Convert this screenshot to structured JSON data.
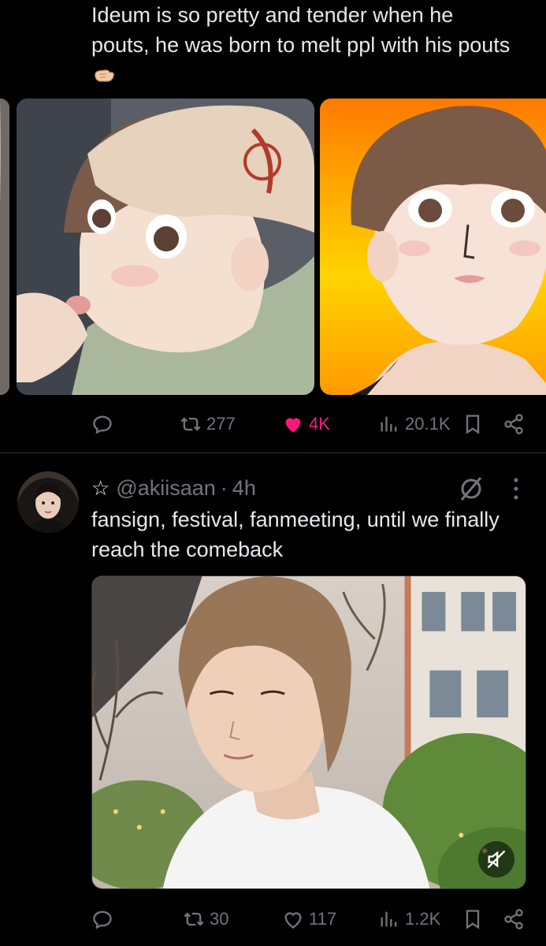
{
  "tweet1": {
    "text": "Ideum is so pretty and tender when he pouts, he was born to melt ppl with his pouts",
    "emoji": "pinching-hand-emoji",
    "actions": {
      "reply_icon": "reply-icon",
      "retweets": "277",
      "likes": "4K",
      "views": "20.1K",
      "liked_color": "#f91880"
    }
  },
  "tweet2": {
    "handle": "@akiisaan",
    "separator": "·",
    "time": "4h",
    "text": "fansign, festival, fanmeeting, until we finally reach the comeback",
    "actions": {
      "retweets": "30",
      "likes": "117",
      "views": "1.2K"
    }
  },
  "colors": {
    "background": "#000000",
    "text": "#e7e9ea",
    "muted": "#71767b",
    "divider": "#2f3336",
    "like": "#f91880"
  }
}
